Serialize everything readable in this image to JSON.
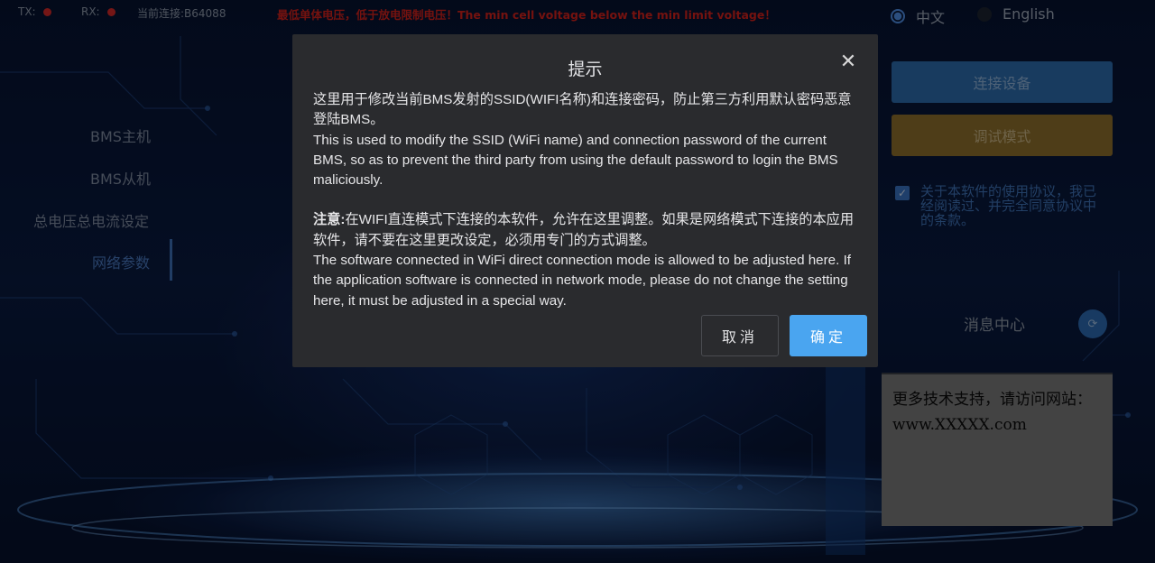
{
  "status_bar": {
    "tx_label": "TX:",
    "rx_label": "RX:",
    "connection": "当前连接:B64088",
    "warning": "最低单体电压，低于放电限制电压！The min cell voltage below the min limit voltage！"
  },
  "language": {
    "options": [
      {
        "label": "中文",
        "selected": true
      },
      {
        "label": "English",
        "selected": false
      }
    ]
  },
  "sidebar": {
    "items": [
      {
        "label": "BMS主机",
        "active": false
      },
      {
        "label": "BMS从机",
        "active": false
      },
      {
        "label": "总电压总电流设定",
        "active": false
      },
      {
        "label": "网络参数",
        "active": true
      }
    ]
  },
  "right_panel": {
    "connect_button": "连接设备",
    "debug_button": "调试模式",
    "agreement": {
      "checked": true,
      "text": "关于本软件的使用协议，我已经阅读过、并完全同意协议中的条款。"
    },
    "message_center": {
      "title": "消息中心",
      "content": "更多技术支持，请访问网站：www.XXXXX.com"
    }
  },
  "dialog": {
    "title": "提示",
    "para1_cn": "这里用于修改当前BMS发射的SSID(WIFI名称)和连接密码，防止第三方利用默认密码恶意登陆BMS。",
    "para1_en": "This is used to modify the SSID (WiFi name) and connection password of the current BMS, so as to prevent the third party from using the default password to login the BMS maliciously.",
    "note_label": "注意:",
    "para2_cn": "在WIFI直连模式下连接的本软件，允许在这里调整。如果是网络模式下连接的本应用软件，请不要在这里更改设定，必须用专门的方式调整。",
    "para2_en": "The software connected in WiFi direct connection mode is allowed to be adjusted here. If the application software is connected in network mode, please do not change the setting here, it must be adjusted in a special way.",
    "cancel_button": "取消",
    "ok_button": "确定"
  },
  "colors": {
    "accent": "#4aa5f0",
    "warning": "#d4211c",
    "connect": "#2c6cae",
    "debug": "#8f6f2c",
    "dialog_bg": "#2a2b2e"
  }
}
